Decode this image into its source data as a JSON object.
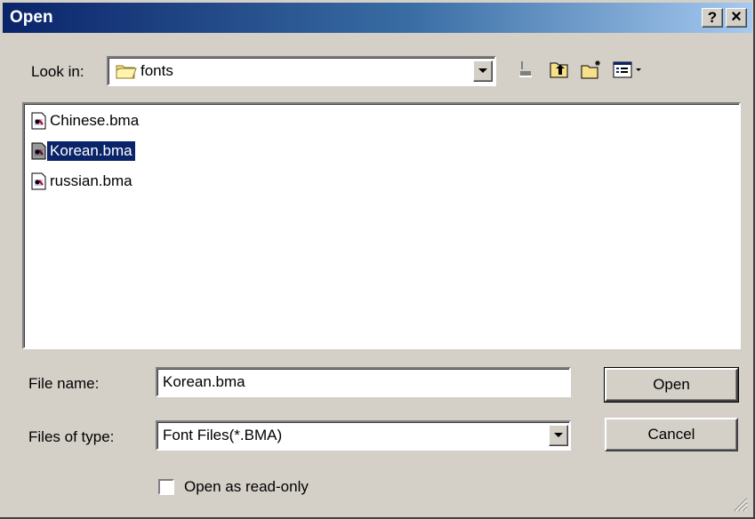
{
  "dialog": {
    "title": "Open",
    "help_label": "?",
    "close_label": "×"
  },
  "look_in": {
    "label": "Look in:",
    "value": "fonts",
    "icon": "folder-icon"
  },
  "toolbar": {
    "buttons": [
      "back-icon",
      "up-one-level-icon",
      "create-new-folder-icon",
      "view-menu-icon"
    ]
  },
  "files": [
    {
      "name": "Chinese.bma",
      "selected": false
    },
    {
      "name": "Korean.bma",
      "selected": true
    },
    {
      "name": "russian.bma",
      "selected": false
    }
  ],
  "file_name": {
    "label": "File name:",
    "value": "Korean.bma"
  },
  "files_of_type": {
    "label": "Files of type:",
    "value": "Font Files(*.BMA)"
  },
  "buttons": {
    "open": "Open",
    "cancel": "Cancel"
  },
  "read_only": {
    "label": "Open as read-only",
    "checked": false
  },
  "colors": {
    "title_bar": "#0a246a",
    "selection": "#0a246a",
    "face": "#d4d0c8"
  }
}
